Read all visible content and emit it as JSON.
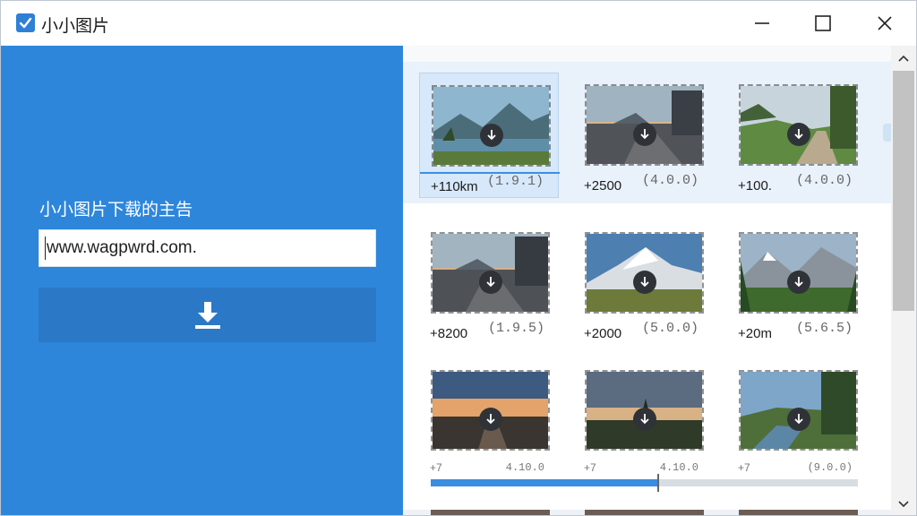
{
  "window": {
    "title": "小小图片",
    "icon": "checkbox-icon",
    "controls": [
      "minimize-icon",
      "maximize-icon",
      "close-icon"
    ]
  },
  "left": {
    "heading": "小小图片下载的主告",
    "url_value": "www.wagpwrd.com.",
    "download_icon": "download-icon",
    "accent": "#2e86db"
  },
  "gallery": {
    "rows": [
      {
        "items": [
          {
            "size": "+110km",
            "dims": "(1.9.1)",
            "scene": "lake-mountains",
            "selected": true
          },
          {
            "size": "+2500",
            "dims": "(4.0.0)",
            "scene": "road-building",
            "selected": false
          },
          {
            "size": "+100.",
            "dims": "(4.0.0)",
            "scene": "meadow-forest",
            "selected": false
          }
        ]
      },
      {
        "items": [
          {
            "size": "+8200",
            "dims": "(1.9.5)",
            "scene": "road-building",
            "selected": false
          },
          {
            "size": "+2000",
            "dims": "(5.0.0)",
            "scene": "snow-mountain",
            "selected": false
          },
          {
            "size": "+20m",
            "dims": "(5.6.5)",
            "scene": "alpine-valley",
            "selected": false
          }
        ]
      },
      {
        "items": [
          {
            "size": "+7",
            "dims": "4.10.0",
            "scene": "sunset-road",
            "selected": false
          },
          {
            "size": "+7",
            "dims": "4.10.0",
            "scene": "tree-sunset",
            "selected": false
          },
          {
            "size": "+7",
            "dims": "(9.0.0)",
            "scene": "river-forest",
            "selected": false
          }
        ]
      }
    ],
    "progress": 0.53
  },
  "scrollbar": {
    "up_icon": "chevron-up-icon",
    "down_icon": "chevron-down-icon",
    "position": 0.0
  }
}
